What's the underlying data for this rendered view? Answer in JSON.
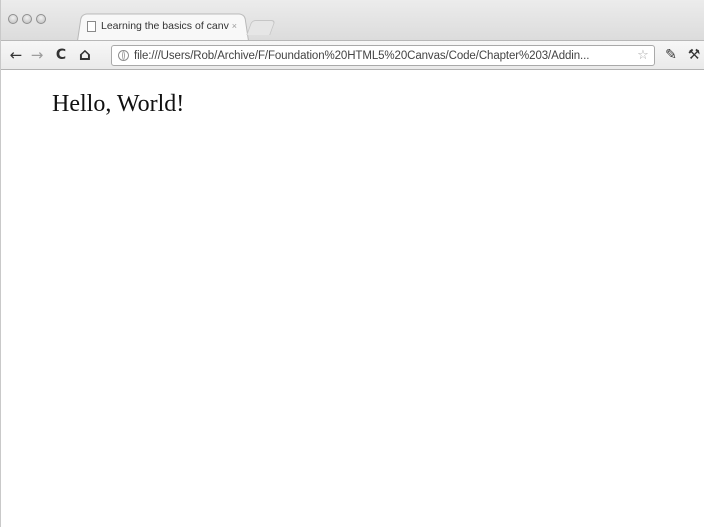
{
  "window": {
    "traffic_lights": [
      "close",
      "minimize",
      "zoom"
    ]
  },
  "tab": {
    "title": "Learning the basics of canvas",
    "close_glyph": "×",
    "icon": "page-icon"
  },
  "toolbar": {
    "back_glyph": "←",
    "forward_glyph": "→",
    "reload_glyph": "C",
    "home_glyph": "⌂",
    "url": "file:///Users/Rob/Archive/F/Foundation%20HTML5%20Canvas/Code/Chapter%203/Addin...",
    "star_glyph": "☆",
    "page_menu_glyph": "✎",
    "wrench_glyph": "⚒",
    "icons": [
      "back-icon",
      "forward-icon",
      "reload-icon",
      "home-icon",
      "globe-icon",
      "bookmark-star-icon",
      "page-menu-icon",
      "wrench-icon"
    ]
  },
  "page": {
    "heading": "Hello, World!"
  }
}
